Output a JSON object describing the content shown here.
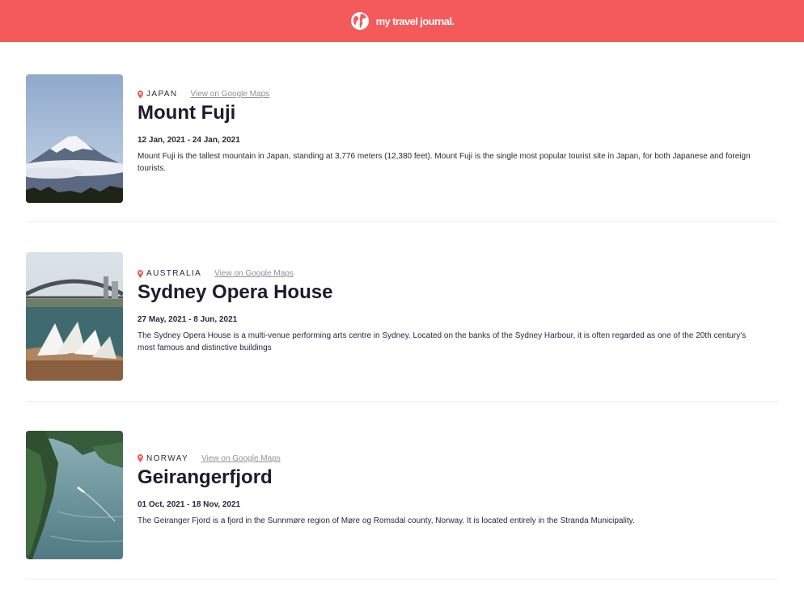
{
  "header": {
    "title": "my travel journal.",
    "icon": "globe-icon"
  },
  "colors": {
    "accent": "#f55a5a",
    "text": "#2b283a",
    "muted": "#918e9b"
  },
  "entries": [
    {
      "country": "JAPAN",
      "map_link": "View on Google Maps",
      "place": "Mount Fuji",
      "dates": "12 Jan, 2021 - 24 Jan, 2021",
      "description": "Mount Fuji is the tallest mountain in Japan, standing at 3,776 meters (12,380 feet). Mount Fuji is the single most popular tourist site in Japan, for both Japanese and foreign tourists."
    },
    {
      "country": "AUSTRALIA",
      "map_link": "View on Google Maps",
      "place": "Sydney Opera House",
      "dates": "27 May, 2021 - 8 Jun, 2021",
      "description": "The Sydney Opera House is a multi-venue performing arts centre in Sydney. Located on the banks of the Sydney Harbour, it is often regarded as one of the 20th century's most famous and distinctive buildings"
    },
    {
      "country": "NORWAY",
      "map_link": "View on Google Maps",
      "place": "Geirangerfjord",
      "dates": "01 Oct, 2021 - 18 Nov, 2021",
      "description": "The Geiranger Fjord is a fjord in the Sunnmøre region of Møre og Romsdal county, Norway. It is located entirely in the Stranda Municipality."
    }
  ]
}
